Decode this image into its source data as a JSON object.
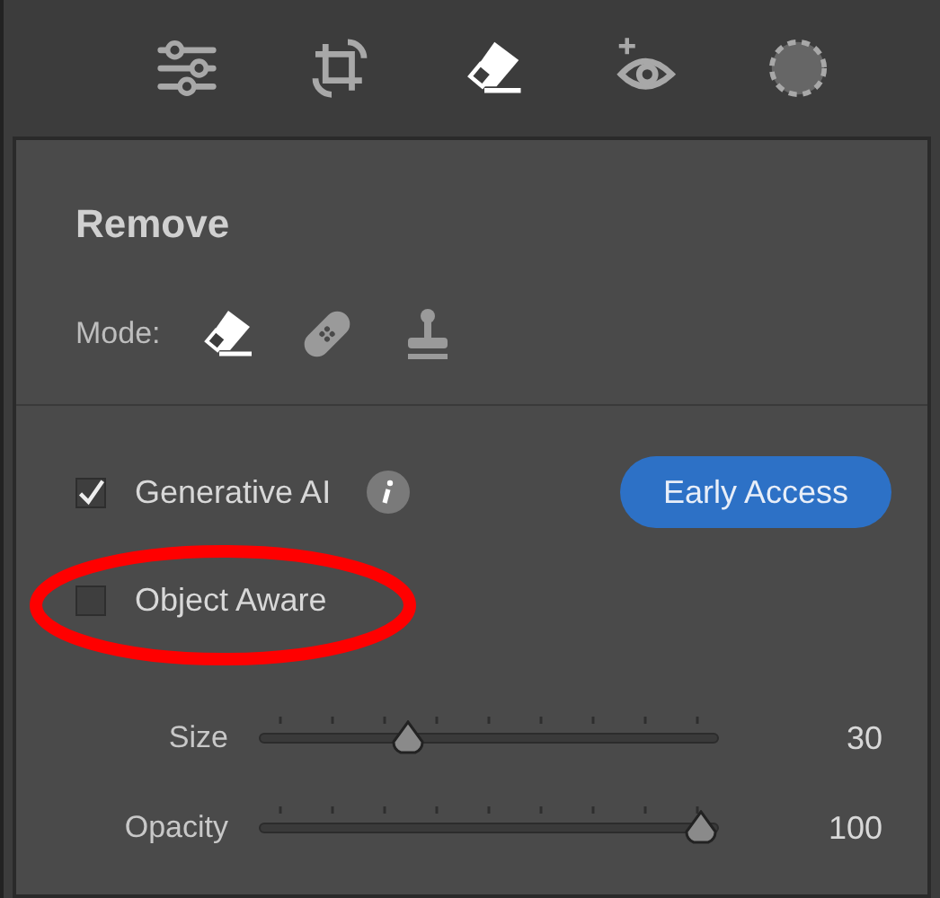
{
  "toolbar": [
    {
      "kind": "sliders",
      "selected": false
    },
    {
      "kind": "crop",
      "selected": false
    },
    {
      "kind": "eraser",
      "selected": true
    },
    {
      "kind": "eye",
      "selected": false
    },
    {
      "kind": "mask",
      "selected": false
    }
  ],
  "panel": {
    "title": "Remove",
    "mode_label": "Mode:",
    "modes": [
      {
        "kind": "eraser",
        "selected": true
      },
      {
        "kind": "bandage",
        "selected": false
      },
      {
        "kind": "stamp",
        "selected": false
      }
    ],
    "options": [
      {
        "label": "Generative AI",
        "checked": true,
        "info": true
      },
      {
        "label": "Object Aware",
        "checked": false,
        "info": false
      }
    ],
    "badge": "Early Access",
    "sliders": [
      {
        "label": "Size",
        "level": 0.31,
        "reading": "30"
      },
      {
        "label": "Opacity",
        "level": 1,
        "reading": "100"
      }
    ]
  }
}
